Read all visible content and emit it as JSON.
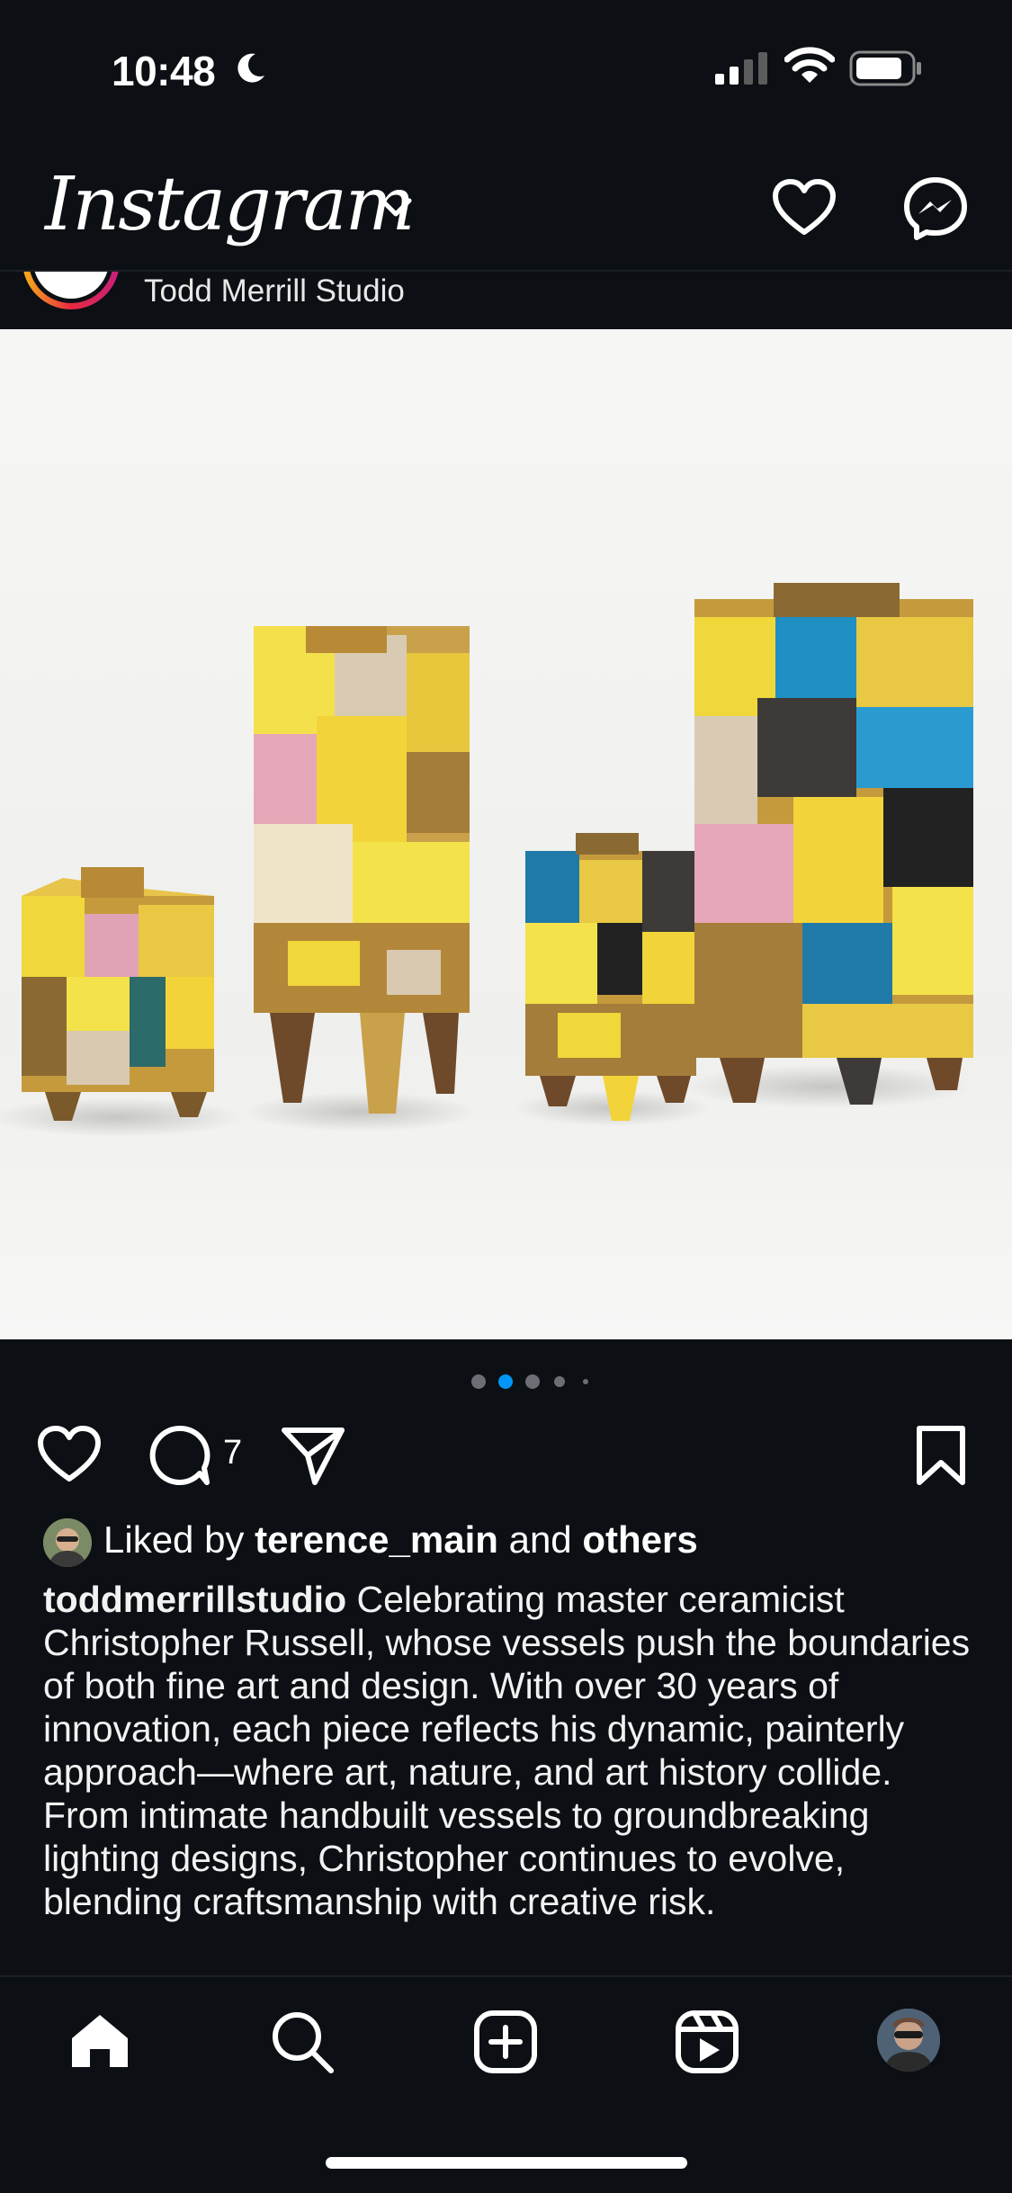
{
  "status_bar": {
    "time": "10:48",
    "icons": [
      "moon-icon",
      "signal-icon",
      "wifi-icon",
      "battery-icon"
    ]
  },
  "top_bar": {
    "logo_text": "Instagram",
    "icons": [
      "chevron-down-icon",
      "heart-icon",
      "messenger-icon"
    ]
  },
  "post": {
    "account_display_name": "Todd Merrill Studio",
    "carousel": {
      "count": 5,
      "active_index": 1
    },
    "comment_count": "7",
    "likes": {
      "prefix": "Liked by",
      "user": "terence_main",
      "connector": "and",
      "others": "others"
    },
    "caption": {
      "username": "toddmerrillstudio",
      "text": "Celebrating master ceramicist Christopher Russell, whose vessels push the boundaries of both fine art and design. With over 30 years of innovation, each piece reflects his dynamic, painterly approach—where art, nature, and art history collide. From intimate handbuilt vessels to groundbreaking lighting designs, Christopher continues to evolve, blending craftsmanship with creative risk."
    }
  },
  "bottom_nav": {
    "items": [
      "home-icon",
      "search-icon",
      "create-icon",
      "reels-icon",
      "profile-avatar"
    ]
  },
  "colors": {
    "background": "#0c0f14",
    "accent_blue": "#0095f6",
    "ceramic_yellow": "#f2d43a"
  }
}
